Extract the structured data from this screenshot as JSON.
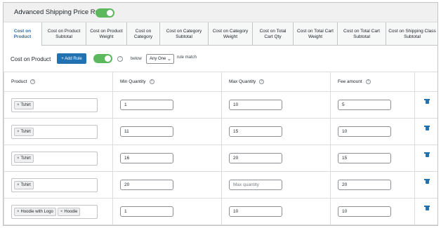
{
  "header": {
    "title": "Advanced Shipping Price Rules",
    "enabled": true
  },
  "tabs": [
    {
      "label": "Cost on Product",
      "active": true
    },
    {
      "label": "Cost on Product Subtotal",
      "active": false
    },
    {
      "label": "Cost on Product Weight",
      "active": false
    },
    {
      "label": "Cost on Category",
      "active": false
    },
    {
      "label": "Cost on Category Subtotal",
      "active": false
    },
    {
      "label": "Cost on Category Weight",
      "active": false
    },
    {
      "label": "Cost on Total Cart Qty",
      "active": false
    },
    {
      "label": "Cost on Total Cart Weight",
      "active": false
    },
    {
      "label": "Cost on Total Cart Subtotal",
      "active": false
    },
    {
      "label": "Cost on Shipping Class Subtotal",
      "active": false
    }
  ],
  "section": {
    "title": "Cost on Product",
    "add_rule_label": "+ Add Rule",
    "enabled": true,
    "below_label": "below",
    "match_select": "Any One",
    "rule_match_label": "rule match"
  },
  "table": {
    "headers": {
      "product": "Product",
      "min_qty": "Min Quantity",
      "max_qty": "Max Quantity",
      "fee": "Fee amount"
    },
    "max_qty_placeholder": "Max quantity",
    "rows": [
      {
        "products": [
          "Tshirt"
        ],
        "min": "1",
        "max": "10",
        "fee": "5"
      },
      {
        "products": [
          "Tshirt"
        ],
        "min": "11",
        "max": "15",
        "fee": "10"
      },
      {
        "products": [
          "Tshirt"
        ],
        "min": "16",
        "max": "20",
        "fee": "15"
      },
      {
        "products": [
          "Tshirt"
        ],
        "min": "20",
        "max": "",
        "fee": "20"
      },
      {
        "products": [
          "Hoodie with Logo",
          "Hoodie"
        ],
        "min": "1",
        "max": "10",
        "fee": "10"
      }
    ]
  },
  "colors": {
    "accent": "#2271b1",
    "toggle_on": "#5cb85c"
  },
  "icons": {
    "help": "question-circle-icon",
    "delete": "trash-icon",
    "tag_remove": "x-icon"
  }
}
